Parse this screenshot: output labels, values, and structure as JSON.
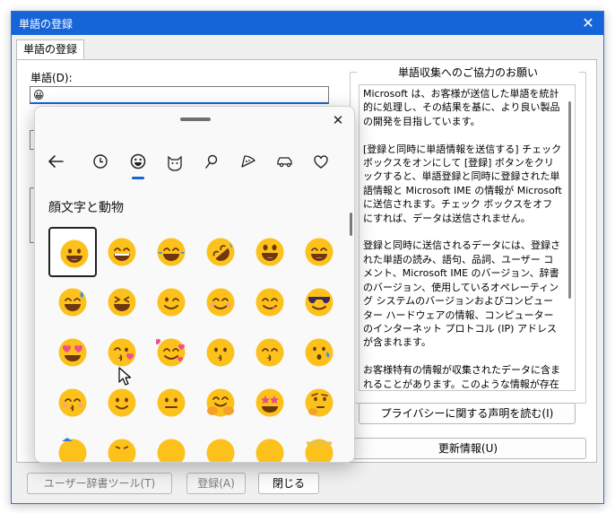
{
  "window": {
    "title": "単語の登録",
    "close_glyph": "✕"
  },
  "tabs": [
    {
      "label": "単語の登録"
    }
  ],
  "form": {
    "word_label": "単語(D):",
    "word_value": "😀"
  },
  "info": {
    "title": "単語収集へのご協力のお願い",
    "text": "Microsoft は、お客様が送信した単語を統計的に処理し、その結果を基に、より良い製品の開発を目指しています。\n\n[登録と同時に単語情報を送信する] チェック ボックスをオンにして [登録] ボタンをクリックすると、単語登録と同時に登録された単語情報と Microsoft IME の情報が Microsoft に送信されます。チェック ボックスをオフにすれば、データは送信されません。\n\n登録と同時に送信されるデータには、登録された単語の読み、語句、品詞、ユーザー コメント、Microsoft IME のバージョン、辞書のバージョン、使用しているオペレーティング システムのバージョンおよびコンピューター ハードウェアの情報、コンピューターのインターネット プロトコル (IP) アドレスが含まれます。\n\nお客様特有の情報が収集されたデータに含まれることがあります。このような情報が存在する場合でも、Microsoft では、お客様を特定するために使用することはありません。"
  },
  "buttons": {
    "privacy": "プライバシーに関する声明を読む(I)",
    "update": "更新情報(U)",
    "user_dict_tool": "ユーザー辞書ツール(T)",
    "register": "登録(A)",
    "close": "閉じる"
  },
  "emoji_panel": {
    "close_glyph": "✕",
    "categories": [
      {
        "icon": "back-arrow-icon"
      },
      {
        "icon": "clock-icon"
      },
      {
        "icon": "smiley-icon",
        "active": true
      },
      {
        "icon": "cat-face-icon"
      },
      {
        "icon": "pin-icon"
      },
      {
        "icon": "pizza-icon"
      },
      {
        "icon": "car-icon"
      },
      {
        "icon": "heart-icon"
      }
    ],
    "section_title": "顔文字と動物",
    "emoji_rows": [
      [
        "grinning-face",
        "beaming-face",
        "tears-of-joy",
        "rolling-laughing",
        "grinning-big-eyes",
        "grinning-smiling-eyes"
      ],
      [
        "sweat-smile",
        "squinting-face",
        "winking-face",
        "smiling-eyes",
        "face-savoring",
        "sunglasses-face"
      ],
      [
        "heart-eyes",
        "kissing-heart",
        "smiling-hearts",
        "kissing-face",
        "kissing-closed-eyes",
        "kissing-smiling-eyes"
      ],
      [
        "kissing-blush",
        "slightly-smiling",
        "neutral-face",
        "hugging-face",
        "star-struck",
        "thinking-face"
      ],
      [
        "partial-1",
        "partial-2",
        "partial-3",
        "partial-4",
        "partial-5",
        "partial-6"
      ]
    ],
    "selected_index": 0,
    "colors": {
      "accent": "#1565d8",
      "emoji_yellow": "#fcc21b",
      "mouth": "#6e3710",
      "tongue": "#f0588a",
      "tears": "#3b8fe8"
    }
  }
}
